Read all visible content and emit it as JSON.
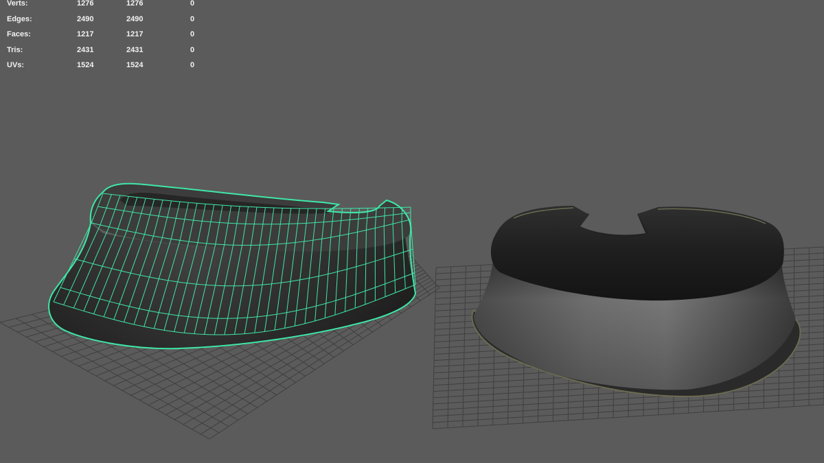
{
  "viewport": {
    "background": "#5b5b5b",
    "wire_color": "#3fe8a8",
    "grid_color": "#3f3f3f"
  },
  "poly_count": {
    "rows": [
      {
        "label": "Verts:",
        "v1": "1276",
        "v2": "1276",
        "v3": "0"
      },
      {
        "label": "Edges:",
        "v1": "2490",
        "v2": "2490",
        "v3": "0"
      },
      {
        "label": "Faces:",
        "v1": "1217",
        "v2": "1217",
        "v3": "0"
      },
      {
        "label": "Tris:",
        "v1": "2431",
        "v2": "2431",
        "v3": "0"
      },
      {
        "label": "UVs:",
        "v1": "1524",
        "v2": "1524",
        "v3": "0"
      }
    ]
  },
  "objects": {
    "left": "collar-wireframe",
    "right": "collar-shaded"
  }
}
